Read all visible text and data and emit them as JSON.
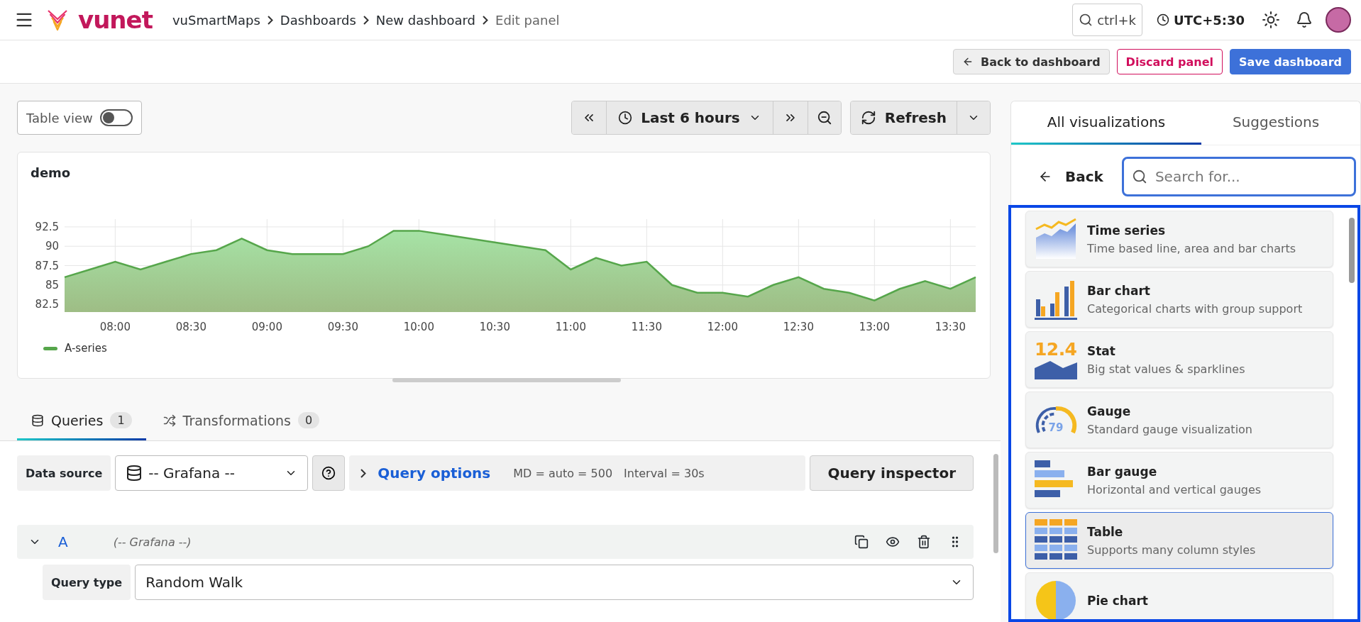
{
  "header": {
    "logo_text": "vunet",
    "breadcrumbs": [
      {
        "label": "vuSmartMaps",
        "current": false
      },
      {
        "label": "Dashboards",
        "current": false
      },
      {
        "label": "New dashboard",
        "current": false
      },
      {
        "label": "Edit panel",
        "current": true
      }
    ],
    "search_shortcut": "ctrl+k",
    "timezone": "UTC+5:30"
  },
  "actions": [
    {
      "label": "Back to dashboard",
      "kind": "secondary"
    },
    {
      "label": "Discard panel",
      "kind": "danger"
    },
    {
      "label": "Save dashboard",
      "kind": "primary"
    }
  ],
  "table_view": {
    "label": "Table view",
    "on": false
  },
  "time_range": {
    "label": "Last 6 hours"
  },
  "refresh": {
    "label": "Refresh"
  },
  "panel": {
    "title": "demo",
    "chart_data": {
      "type": "area",
      "x": [
        460,
        470,
        480,
        490,
        500,
        510,
        520,
        530,
        540,
        550,
        560,
        570,
        580,
        590,
        600,
        610,
        620,
        630,
        640,
        650,
        660,
        670,
        680,
        690,
        700,
        710,
        720,
        730,
        740,
        750,
        760,
        770,
        780,
        790,
        800,
        810,
        820
      ],
      "series": [
        {
          "name": "A-series",
          "color": "#56a64b",
          "values": [
            86,
            87,
            88,
            87,
            88,
            89,
            89.5,
            91,
            89.5,
            89,
            89,
            89,
            90,
            92,
            92,
            91.5,
            91,
            90.5,
            90,
            89.5,
            87,
            88.5,
            87.5,
            88,
            85,
            84,
            84,
            83.5,
            85,
            86,
            84.5,
            84,
            83,
            84.5,
            85.5,
            84.5,
            86
          ]
        }
      ],
      "grid": true,
      "xlim": [
        460,
        820
      ],
      "ylim": [
        81.5,
        93.5
      ],
      "xticks": [
        {
          "value": 480,
          "label": "08:00"
        },
        {
          "value": 510,
          "label": "08:30"
        },
        {
          "value": 540,
          "label": "09:00"
        },
        {
          "value": 570,
          "label": "09:30"
        },
        {
          "value": 600,
          "label": "10:00"
        },
        {
          "value": 630,
          "label": "10:30"
        },
        {
          "value": 660,
          "label": "11:00"
        },
        {
          "value": 690,
          "label": "11:30"
        },
        {
          "value": 720,
          "label": "12:00"
        },
        {
          "value": 750,
          "label": "12:30"
        },
        {
          "value": 780,
          "label": "13:00"
        },
        {
          "value": 810,
          "label": "13:30"
        }
      ],
      "yticks": [
        82.5,
        85,
        87.5,
        90,
        92.5
      ]
    }
  },
  "query_tabs": [
    {
      "label": "Queries",
      "count": "1",
      "selected": true,
      "kind": "queries"
    },
    {
      "label": "Transformations",
      "count": "0",
      "selected": false,
      "kind": "transformations"
    }
  ],
  "query": {
    "data_source_label": "Data source",
    "data_source": "-- Grafana --",
    "options_label": "Query options",
    "md": "MD = auto = 500",
    "interval": "Interval = 30s",
    "inspector": "Query inspector",
    "ref_id": "A",
    "ref_source": "(-- Grafana --)",
    "query_type_label": "Query type",
    "query_type": "Random Walk"
  },
  "viz": {
    "tabs": [
      {
        "label": "All visualizations",
        "selected": true
      },
      {
        "label": "Suggestions",
        "selected": false
      }
    ],
    "back": "Back",
    "search_placeholder": "Search for...",
    "items": [
      {
        "kind": "timeseries",
        "title": "Time series",
        "description": "Time based line, area and bar charts",
        "selected": false
      },
      {
        "kind": "barchart",
        "title": "Bar chart",
        "description": "Categorical charts with group support",
        "selected": false
      },
      {
        "kind": "stat",
        "title": "Stat",
        "description": "Big stat values & sparklines",
        "icon_text": "12.4",
        "selected": false
      },
      {
        "kind": "gauge",
        "title": "Gauge",
        "description": "Standard gauge visualization",
        "icon_text": "79",
        "selected": false
      },
      {
        "kind": "bargauge",
        "title": "Bar gauge",
        "description": "Horizontal and vertical gauges",
        "selected": false
      },
      {
        "kind": "table",
        "title": "Table",
        "description": "Supports many column styles",
        "selected": true
      },
      {
        "kind": "pie",
        "title": "Pie chart",
        "selected": false
      }
    ]
  }
}
